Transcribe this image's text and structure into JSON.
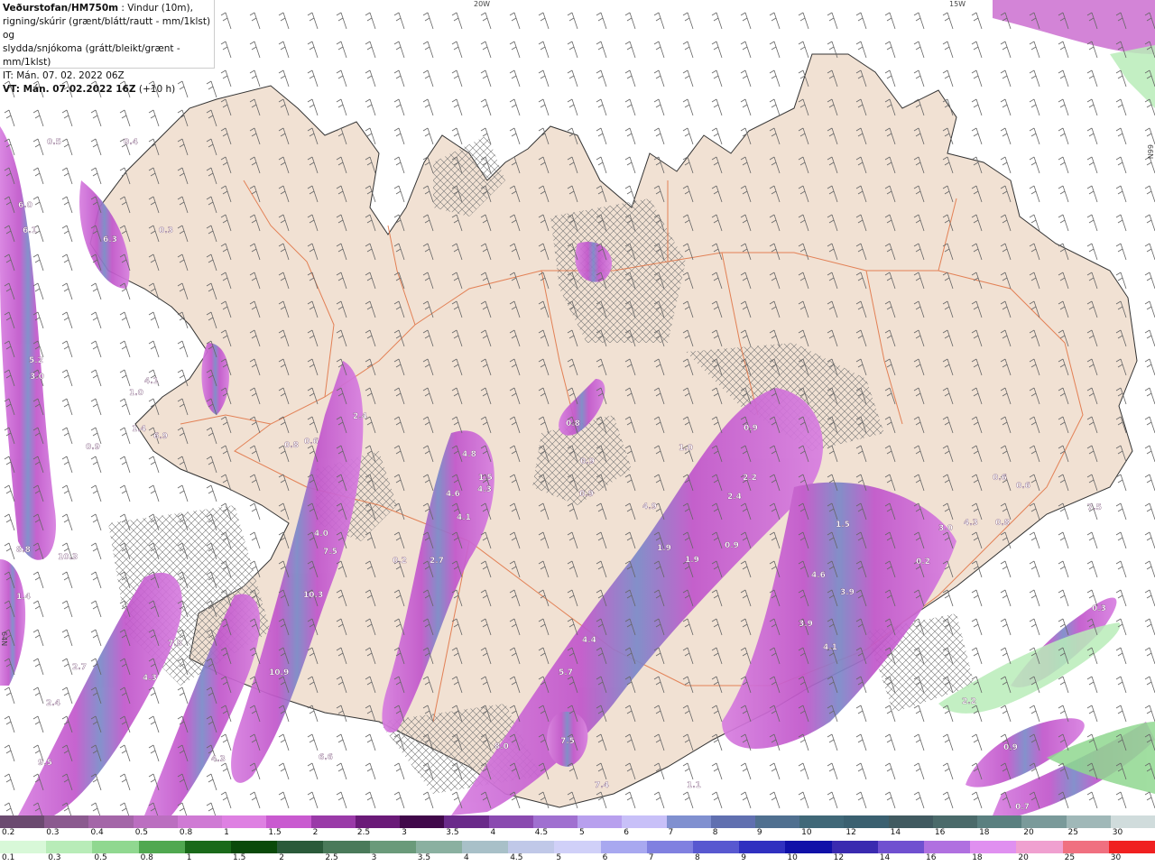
{
  "header": {
    "title": "Veðurstofan/HM750m",
    "description_line1": " : Vindur (10m),",
    "description_line2": "rigning/skúrir (grænt/blátt/rautt - mm/1klst) og",
    "description_line3": "slydda/snjókoma (grátt/bleikt/grænt - mm/1klst)",
    "it_line": "IT: Mán. 07. 02. 2022 06Z",
    "vt_label": "VT: Mán. 07.02.2022 16Z",
    "vt_offset": " (+10 h)"
  },
  "map": {
    "land_color": "#f1e1d3",
    "road_color": "#e07040",
    "longitude_labels": [
      "20W",
      "15W"
    ],
    "latitude_labels": [
      "66N",
      "64N"
    ],
    "value_labels": [
      {
        "text": "0.5"
      },
      {
        "text": "0.4"
      },
      {
        "text": "6.0"
      },
      {
        "text": "6.1"
      },
      {
        "text": "6.3"
      },
      {
        "text": "0.3"
      },
      {
        "text": "5.2"
      },
      {
        "text": "3.0"
      },
      {
        "text": "4.1"
      },
      {
        "text": "1.0"
      },
      {
        "text": "1.4"
      },
      {
        "text": "6.9"
      },
      {
        "text": "0.9"
      },
      {
        "text": "2.4"
      },
      {
        "text": "0.8"
      },
      {
        "text": "0.6"
      },
      {
        "text": "8.8"
      },
      {
        "text": "10.3"
      },
      {
        "text": "1.4"
      },
      {
        "text": "4.0"
      },
      {
        "text": "7.5"
      },
      {
        "text": "10.3"
      },
      {
        "text": "2.7"
      },
      {
        "text": "4.3"
      },
      {
        "text": "7.8"
      },
      {
        "text": "10.9"
      },
      {
        "text": "2.4"
      },
      {
        "text": "9.5"
      },
      {
        "text": "4.3"
      },
      {
        "text": "6.6"
      },
      {
        "text": "0.8"
      },
      {
        "text": "4.8"
      },
      {
        "text": "4.3"
      },
      {
        "text": "1.5"
      },
      {
        "text": "4.6"
      },
      {
        "text": "4.1"
      },
      {
        "text": "2.7"
      },
      {
        "text": "0.2"
      },
      {
        "text": "0.9"
      },
      {
        "text": "0.9"
      },
      {
        "text": "1.0"
      },
      {
        "text": "0.9"
      },
      {
        "text": "1.9"
      },
      {
        "text": "2.2"
      },
      {
        "text": "2.4"
      },
      {
        "text": "1.5"
      },
      {
        "text": "4.9"
      },
      {
        "text": "1.9"
      },
      {
        "text": "0.9"
      },
      {
        "text": "4.6"
      },
      {
        "text": "3.9"
      },
      {
        "text": "3.9"
      },
      {
        "text": "4.1"
      },
      {
        "text": "4.4"
      },
      {
        "text": "5.7"
      },
      {
        "text": "8.0"
      },
      {
        "text": "7.5"
      },
      {
        "text": "7.4"
      },
      {
        "text": "1.1"
      },
      {
        "text": "4.3"
      },
      {
        "text": "0.8"
      },
      {
        "text": "0.6"
      },
      {
        "text": "0.6"
      },
      {
        "text": "0.2"
      },
      {
        "text": "0.3"
      },
      {
        "text": "2.2"
      },
      {
        "text": "0.9"
      },
      {
        "text": "0.7"
      },
      {
        "text": "7.5"
      },
      {
        "text": "3.0"
      },
      {
        "text": "0.2"
      },
      {
        "text": "5.2"
      }
    ]
  },
  "legend": {
    "snow_scale": {
      "labels": [
        "0.2",
        "0.3",
        "0.4",
        "0.5",
        "0.8",
        "1",
        "1.5",
        "2",
        "2.5",
        "3",
        "3.5",
        "4",
        "4.5",
        "5",
        "6",
        "7",
        "8",
        "9",
        "10",
        "12",
        "14",
        "16",
        "18",
        "20",
        "25",
        "30"
      ],
      "colors": [
        "#6b4a70",
        "#8b5a8f",
        "#a466a8",
        "#bb6fc0",
        "#cf7ad4",
        "#de80e2",
        "#c95ad0",
        "#9a3aa8",
        "#6a1a78",
        "#40084a",
        "#6a2a8a",
        "#8a4ab0",
        "#a070d0",
        "#b8a0ee",
        "#c8c0f8",
        "#8090d0",
        "#6070b0",
        "#507090",
        "#406878",
        "#3a6070",
        "#405a60",
        "#4a6a6a",
        "#5a8080",
        "#7a9a9a",
        "#a0b8b8",
        "#d0dcdc"
      ]
    },
    "rain_scale": {
      "labels": [
        "0.1",
        "0.3",
        "0.5",
        "0.8",
        "1",
        "1.5",
        "2",
        "2.5",
        "3",
        "3.5",
        "4",
        "4.5",
        "5",
        "6",
        "7",
        "8",
        "9",
        "10",
        "12",
        "14",
        "16",
        "18",
        "20",
        "25",
        "30"
      ],
      "colors": [
        "#d8f8d8",
        "#b8ecb8",
        "#90d890",
        "#50a850",
        "#1a6a1a",
        "#0a4a0a",
        "#2a5a3a",
        "#4a7a5a",
        "#6a9a7a",
        "#8ab0a0",
        "#a8c0c8",
        "#c0c8e8",
        "#d0d0f8",
        "#a8a8f0",
        "#8080e0",
        "#5858d0",
        "#3030c0",
        "#1010a8",
        "#3a2ab0",
        "#7050d0",
        "#b070e0",
        "#e090f0",
        "#f0a0d0",
        "#f07080",
        "#f02020"
      ]
    }
  }
}
